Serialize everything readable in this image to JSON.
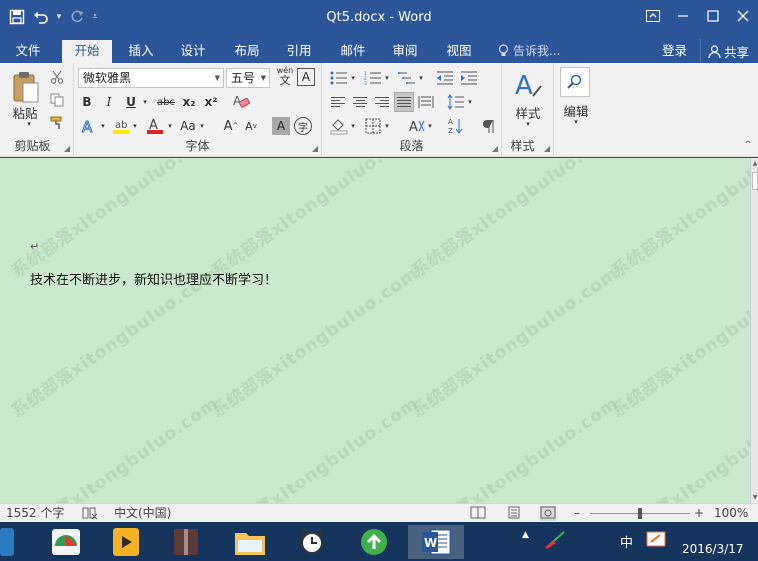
{
  "app": {
    "doc_title": "Qt5.docx - Word"
  },
  "window_controls": {
    "ribbon_options_icon": "ribbon-display-icon",
    "minimize": "minimize-icon",
    "maximize": "maximize-icon",
    "close": "close-icon"
  },
  "tabs": [
    {
      "label": "文件"
    },
    {
      "label": "开始"
    },
    {
      "label": "插入"
    },
    {
      "label": "设计"
    },
    {
      "label": "布局"
    },
    {
      "label": "引用"
    },
    {
      "label": "邮件"
    },
    {
      "label": "审阅"
    },
    {
      "label": "视图"
    }
  ],
  "tell_me": "告诉我...",
  "sign_in": "登录",
  "share": "共享",
  "ribbon": {
    "clipboard": {
      "paste_label": "粘贴",
      "group_label": "剪贴板"
    },
    "font": {
      "font_name": "微软雅黑",
      "font_size": "五号",
      "pinyin": "wén",
      "bold": "B",
      "italic": "I",
      "underline": "U",
      "strikethrough": "abc",
      "subscript": "x₂",
      "superscript": "x²",
      "change_case": "Aa",
      "grow_font": "A",
      "shrink_font": "A",
      "char_shading": "A",
      "enclose": "字",
      "group_label": "字体"
    },
    "paragraph": {
      "group_label": "段落"
    },
    "styles": {
      "label": "样式",
      "group_label": "样式"
    },
    "editing": {
      "label": "编辑"
    }
  },
  "document": {
    "paragraph_mark": "↵",
    "body_text": "技术在不断进步，新知识也理应不断学习！",
    "watermark": "系统部落xitongbuluo.com"
  },
  "status": {
    "word_count": "1552 个字",
    "language": "中文(中国)",
    "zoom": "100%"
  },
  "taskbar": {
    "ime": "中",
    "date": "2016/3/17"
  },
  "colors": {
    "word_blue": "#2b579a",
    "ribbon_bg": "#f1f1f1",
    "doc_bg": "#cce8cf",
    "taskbar_bg": "#16355e",
    "font_color_red": "#d4262c",
    "highlight_yellow": "#ffeb00"
  }
}
